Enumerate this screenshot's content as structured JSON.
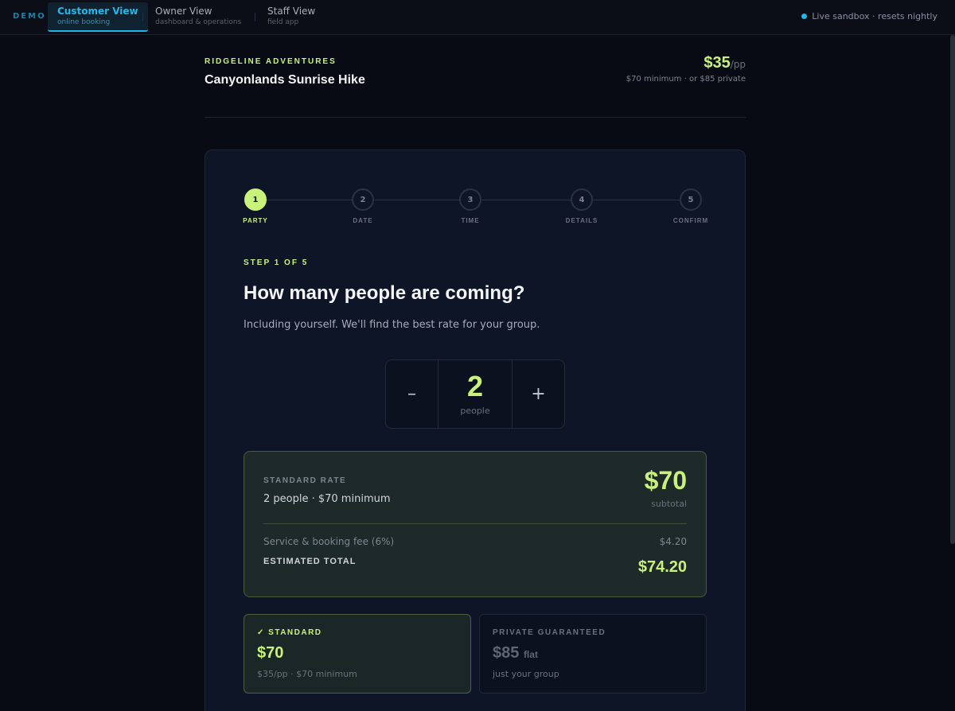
{
  "nav": {
    "demo_label": "DEMO",
    "tabs": [
      {
        "label": "Customer View",
        "sub": "online booking"
      },
      {
        "label": "Owner View",
        "sub": "dashboard & operations"
      },
      {
        "label": "Staff View",
        "sub": "field app"
      }
    ],
    "sandbox_status": "Live sandbox · resets nightly"
  },
  "header": {
    "brand": "RIDGELINE ADVENTURES",
    "tour_title": "Canyonlands Sunrise Hike",
    "price": "$35",
    "price_unit": "/pp",
    "price_note": "$70 minimum · or $85 private"
  },
  "steps": [
    {
      "num": "1",
      "label": "PARTY"
    },
    {
      "num": "2",
      "label": "DATE"
    },
    {
      "num": "3",
      "label": "TIME"
    },
    {
      "num": "4",
      "label": "DETAILS"
    },
    {
      "num": "5",
      "label": "CONFIRM"
    }
  ],
  "current_step": 1,
  "form": {
    "step_of": "STEP 1 OF 5",
    "question": "How many people are coming?",
    "subtext": "Including yourself. We'll find the best rate for your group.",
    "decrement": "–",
    "increment": "+",
    "count": "2",
    "count_unit": "people"
  },
  "summary": {
    "rate_label": "STANDARD RATE",
    "rate_desc": "2 people · $70 minimum",
    "subtotal": "$70",
    "subtotal_label": "subtotal",
    "fee_label": "Service & booking fee (6%)",
    "fee_amount": "$4.20",
    "total_label": "ESTIMATED TOTAL",
    "total_amount": "$74.20"
  },
  "options": {
    "standard": {
      "label": "✓ STANDARD",
      "amount": "$70",
      "sub": "$35/pp · $70 minimum"
    },
    "private": {
      "label": "PRIVATE GUARANTEED",
      "amount": "$85",
      "amount_suffix": "flat",
      "sub": "just your group"
    }
  },
  "colors": {
    "accent": "#c9f27a",
    "nav_accent": "#1fb6e8",
    "background": "#080b13",
    "card": "#0e1527"
  }
}
